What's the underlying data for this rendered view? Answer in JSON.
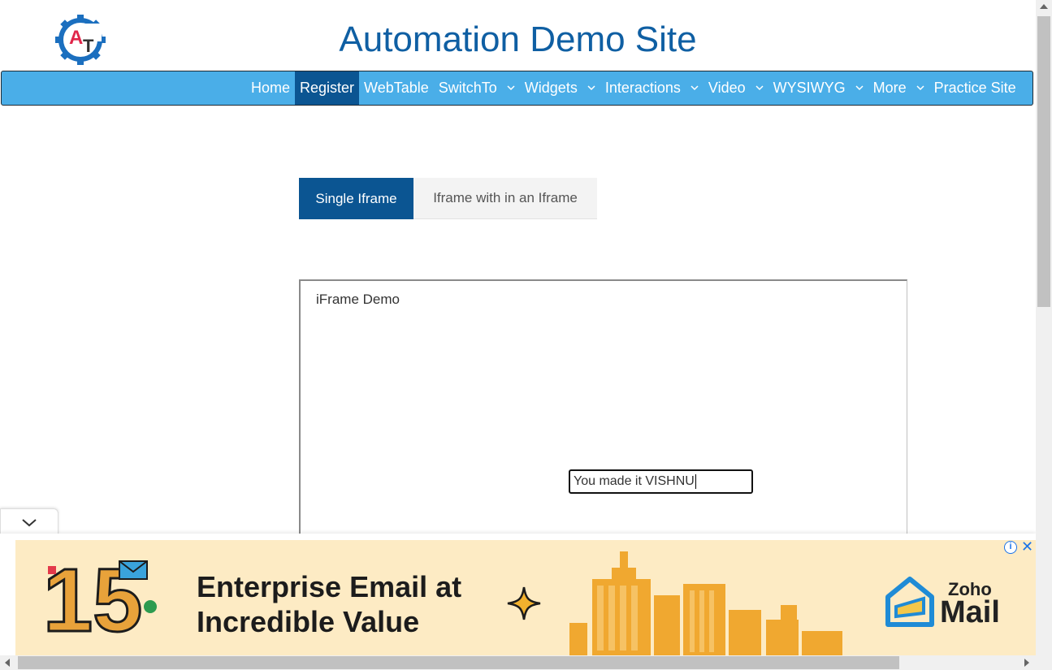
{
  "header": {
    "title": "Automation Demo Site",
    "logo_icon": "gear-logo-icon",
    "logo_letters": {
      "a": "A",
      "t": "T"
    }
  },
  "nav": {
    "items": [
      {
        "label": "Home",
        "dropdown": false,
        "active": false
      },
      {
        "label": "Register",
        "dropdown": false,
        "active": true
      },
      {
        "label": "WebTable",
        "dropdown": false,
        "active": false
      },
      {
        "label": "SwitchTo",
        "dropdown": true,
        "active": false
      },
      {
        "label": "Widgets",
        "dropdown": true,
        "active": false
      },
      {
        "label": "Interactions",
        "dropdown": true,
        "active": false
      },
      {
        "label": "Video",
        "dropdown": true,
        "active": false
      },
      {
        "label": "WYSIWYG",
        "dropdown": true,
        "active": false
      },
      {
        "label": "More",
        "dropdown": true,
        "active": false
      },
      {
        "label": "Practice Site",
        "dropdown": false,
        "active": false
      }
    ]
  },
  "tabs": {
    "single": "Single Iframe",
    "nested": "Iframe with in an Iframe"
  },
  "iframe": {
    "title": "iFrame Demo",
    "input_value": "You made it VISHNU"
  },
  "ad": {
    "number": "15",
    "headline_line1": "Enterprise Email at",
    "headline_line2": "Incredible Value",
    "brand_small": "Zoho",
    "brand_big": "Mail",
    "info_icon": "i",
    "close_icon": "✕"
  },
  "colors": {
    "nav_bg": "#4aaee8",
    "nav_active": "#0b5592",
    "title": "#0f5fa3",
    "ad_bg": "#fdebc4",
    "ad_city": "#f0a830"
  }
}
